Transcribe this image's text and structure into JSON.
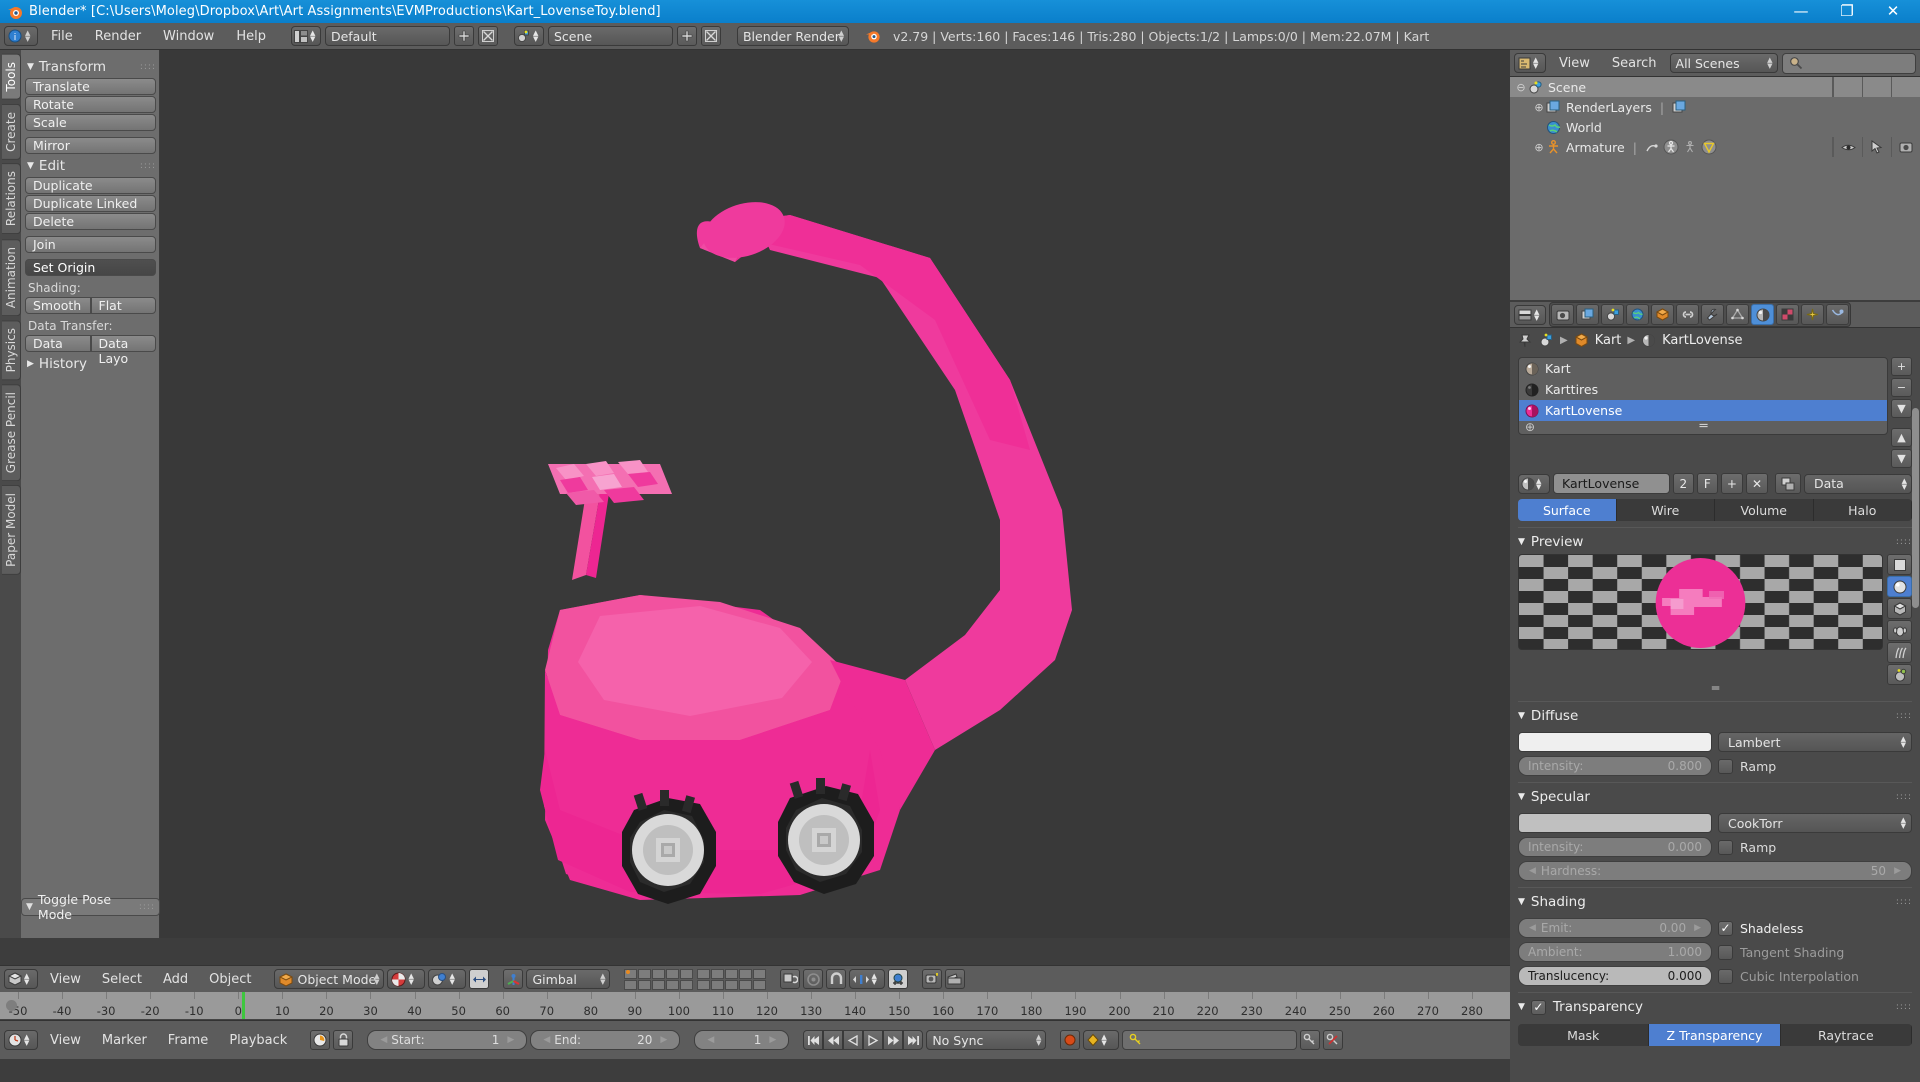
{
  "window": {
    "title": "Blender* [C:\\Users\\Moleg\\Dropbox\\Art\\Art Assignments\\EVMProductions\\Kart_LovenseToy.blend]",
    "minimize": "—",
    "maximize": "❐",
    "close": "✕"
  },
  "info_header": {
    "menus": [
      "File",
      "Render",
      "Window",
      "Help"
    ],
    "screen_layout": "Default",
    "scene": "Scene",
    "engine": "Blender Render",
    "status": "v2.79 | Verts:160 | Faces:146 | Tris:280 | Objects:1/2 | Lamps:0/0 | Mem:22.07M | Kart",
    "add_label": "+",
    "x_label": "✕"
  },
  "toolshelf": {
    "tabs": [
      "Tools",
      "Create",
      "Relations",
      "Animation",
      "Physics",
      "Grease Pencil",
      "Paper Model"
    ],
    "active_tab": "Tools",
    "panels": [
      {
        "title": "Transform",
        "tri": "▼"
      },
      {
        "title": "Edit",
        "tri": "▼"
      },
      {
        "title": "History",
        "tri": "▶"
      }
    ],
    "transform_buttons": [
      "Translate",
      "Rotate",
      "Scale"
    ],
    "mirror_button": "Mirror",
    "edit_buttons": [
      "Duplicate",
      "Duplicate Linked",
      "Delete"
    ],
    "join_button": "Join",
    "set_origin_button": "Set Origin",
    "shading_label": "Shading:",
    "shading_buttons": [
      "Smooth",
      "Flat"
    ],
    "data_transfer_label": "Data Transfer:",
    "data_transfer_buttons": [
      "Data",
      "Data Layo"
    ],
    "operator_panel": "Toggle Pose Mode"
  },
  "view3d_header": {
    "menus": [
      "View",
      "Select",
      "Add",
      "Object"
    ],
    "mode": "Object Mode",
    "transform_orientation": "Gimbal"
  },
  "timeline": {
    "ruler_ticks": [
      -50,
      -40,
      -30,
      -20,
      -10,
      0,
      10,
      20,
      30,
      40,
      50,
      60,
      70,
      80,
      90,
      100,
      110,
      120,
      130,
      140,
      150,
      160,
      170,
      180,
      190,
      200,
      210,
      220,
      230,
      240,
      250,
      260,
      270,
      280
    ],
    "playhead_frame": 1,
    "menus": [
      "View",
      "Marker",
      "Frame",
      "Playback"
    ],
    "start_label": "Start:",
    "start_value": "1",
    "end_label": "End:",
    "end_value": "20",
    "current_frame": "1",
    "sync_mode": "No Sync"
  },
  "outliner": {
    "menus": [
      "View",
      "Search"
    ],
    "display_mode": "All Scenes",
    "search_placeholder": "",
    "rows": [
      {
        "label": "Scene",
        "indent": 0,
        "expander": "⊖",
        "icon": "scene-icon",
        "selected": true
      },
      {
        "label": "RenderLayers",
        "indent": 1,
        "expander": "⊕",
        "icon": "renderlayers-icon",
        "selected": false
      },
      {
        "label": "World",
        "indent": 1,
        "expander": "",
        "icon": "world-icon",
        "selected": false
      },
      {
        "label": "Armature",
        "indent": 1,
        "expander": "⊕",
        "icon": "armature-icon",
        "selected": false
      }
    ]
  },
  "properties": {
    "tabs": [
      "render-icon",
      "render-layers-icon",
      "scene-icon",
      "world-icon",
      "object-icon",
      "constraints-icon",
      "modifiers-icon",
      "data-icon",
      "material-icon",
      "texture-icon",
      "particles-icon",
      "physics-icon"
    ],
    "active_tab_index": 8,
    "breadcrumb": [
      "Kart",
      "KartLovense"
    ],
    "material_slots": [
      {
        "name": "Kart",
        "selected": false,
        "color": "#b9aa99"
      },
      {
        "name": "Karttires",
        "selected": false,
        "color": "#3a3a3a"
      },
      {
        "name": "KartLovense",
        "selected": true,
        "color": "#ec2f96"
      }
    ],
    "slot_buttons": {
      "add": "+",
      "remove": "−",
      "menu": "▼",
      "up": "▲",
      "down": "▼"
    },
    "material_name": "KartLovense",
    "users_count": "2",
    "fake_user": "F",
    "new_material": "+",
    "unlink_material": "✕",
    "datablock_source": "Data",
    "type_tabs": [
      "Surface",
      "Wire",
      "Volume",
      "Halo"
    ],
    "active_type_tab": "Surface",
    "preview": {
      "title": "Preview"
    },
    "diffuse": {
      "title": "Diffuse",
      "color": "#efefef",
      "shader": "Lambert",
      "intensity_label": "Intensity:",
      "intensity_value": "0.800",
      "ramp_label": "Ramp"
    },
    "specular": {
      "title": "Specular",
      "color": "#c0c0c0",
      "shader": "CookTorr",
      "intensity_label": "Intensity:",
      "intensity_value": "0.000",
      "ramp_label": "Ramp",
      "hardness_label": "Hardness:",
      "hardness_value": "50"
    },
    "shading": {
      "title": "Shading",
      "emit_label": "Emit:",
      "emit_value": "0.00",
      "ambient_label": "Ambient:",
      "ambient_value": "1.000",
      "translucency_label": "Translucency:",
      "translucency_value": "0.000",
      "shadeless_label": "Shadeless",
      "shadeless_on": true,
      "tangent_label": "Tangent Shading",
      "tangent_on": false,
      "cubic_label": "Cubic Interpolation",
      "cubic_on": false
    },
    "transparency": {
      "title": "Transparency",
      "enabled": true,
      "modes": [
        "Mask",
        "Z Transparency",
        "Raytrace"
      ],
      "active_mode": "Z Transparency"
    }
  },
  "colors": {
    "accent_blue": "#4e7fd0",
    "title_blue": "#1790d8",
    "model_pink": "#ec2f96",
    "model_pink_light": "#f25aaa",
    "viewport_bg": "#393939"
  }
}
